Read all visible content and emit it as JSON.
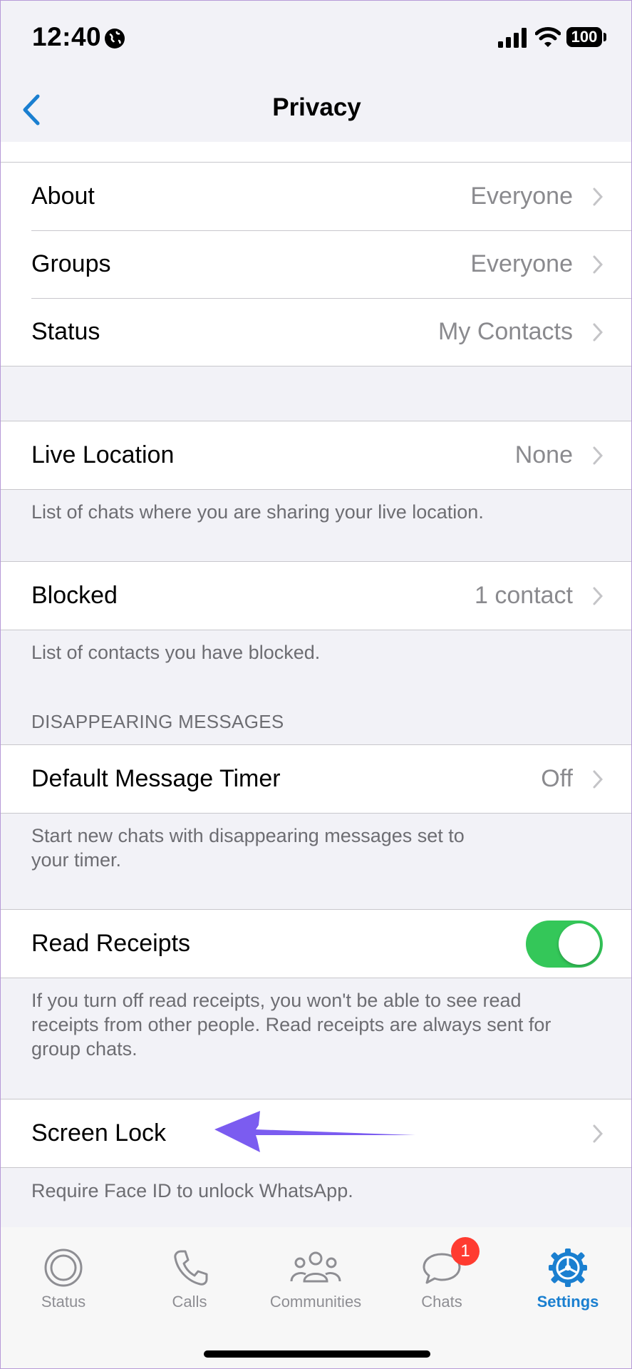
{
  "status_bar": {
    "time": "12:40",
    "battery": "100"
  },
  "nav": {
    "title": "Privacy"
  },
  "group1": {
    "rows": [
      {
        "label": "About",
        "value": "Everyone"
      },
      {
        "label": "Groups",
        "value": "Everyone"
      },
      {
        "label": "Status",
        "value": "My Contacts"
      }
    ]
  },
  "live_location": {
    "label": "Live Location",
    "value": "None",
    "note": "List of chats where you are sharing your live location."
  },
  "blocked": {
    "label": "Blocked",
    "value": "1 contact",
    "note": "List of contacts you have blocked."
  },
  "disappearing": {
    "header": "DISAPPEARING MESSAGES",
    "label": "Default Message Timer",
    "value": "Off",
    "note_line1": "Start new chats with disappearing messages set to",
    "note_line2": "your timer."
  },
  "read_receipts": {
    "label": "Read Receipts",
    "enabled": true,
    "note_line1": "If you turn off read receipts, you won't be able to see read",
    "note_line2": "receipts from other people. Read receipts are always sent for",
    "note_line3": "group chats."
  },
  "screen_lock": {
    "label": "Screen Lock",
    "note": "Require Face ID to unlock WhatsApp."
  },
  "colors": {
    "accent": "#1a7fd0",
    "toggle_on": "#34c759",
    "badge": "#ff3b30",
    "arrow": "#7b5cf0"
  },
  "tabs": [
    {
      "label": "Status",
      "icon": "status-icon"
    },
    {
      "label": "Calls",
      "icon": "phone-icon"
    },
    {
      "label": "Communities",
      "icon": "communities-icon"
    },
    {
      "label": "Chats",
      "icon": "chats-icon",
      "badge": "1"
    },
    {
      "label": "Settings",
      "icon": "settings-icon",
      "active": true
    }
  ]
}
